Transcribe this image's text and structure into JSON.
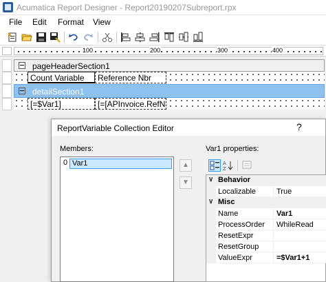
{
  "app": {
    "title": "Acumatica Report Designer - Report20190207Subreport.rpx",
    "icon": "report-designer-icon"
  },
  "menu": {
    "file": "File",
    "edit": "Edit",
    "format": "Format",
    "view": "View"
  },
  "toolbar": {
    "buttons": [
      "new-report",
      "open",
      "save",
      "save-as",
      "undo",
      "redo",
      "cut",
      "align-left",
      "align-center",
      "align-right",
      "align-top",
      "align-middle",
      "align-bottom"
    ]
  },
  "ruler": {
    "ticks": [
      "100",
      "200",
      "300",
      "400"
    ]
  },
  "report": {
    "page_header": "pageHeaderSection1",
    "header_cells": [
      "Count Variable",
      "Reference Nbr"
    ],
    "detail": "detailSection1",
    "detail_cells": [
      "[=$Var1]",
      "[=[APInvoice.RefN"
    ]
  },
  "dialog": {
    "title": "ReportVariable Collection Editor",
    "help": "?",
    "members_label": "Members:",
    "members": [
      {
        "index": "0",
        "name": "Var1"
      }
    ],
    "properties_label": "Var1 properties:",
    "categories": [
      {
        "name": "Behavior",
        "toggle": "∨",
        "props": [
          {
            "name": "Localizable",
            "value": "True"
          }
        ]
      },
      {
        "name": "Misc",
        "toggle": "∨",
        "props": [
          {
            "name": "Name",
            "value": "Var1",
            "bold": true
          },
          {
            "name": "ProcessOrder",
            "value": "WhileRead"
          },
          {
            "name": "ResetExpr",
            "value": ""
          },
          {
            "name": "ResetGroup",
            "value": ""
          },
          {
            "name": "ValueExpr",
            "value": "=$Var1+1",
            "bold": true
          }
        ]
      }
    ]
  },
  "colors": {
    "selected_band": "#8ec1ee",
    "selection_highlight": "#cce8ff",
    "selection_border": "#3399ff"
  }
}
